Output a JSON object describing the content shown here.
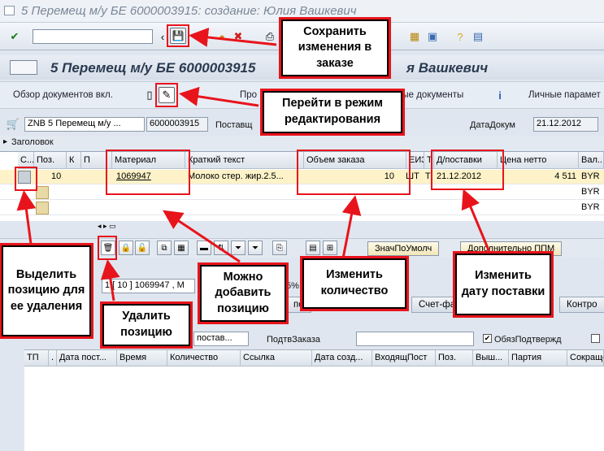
{
  "window": {
    "title": "5 Перемещ м/у БЕ 6000003915: создание: Юлия Вашкевич"
  },
  "app": {
    "title": "5 Перемещ м/у БЕ 6000003915",
    "title_tail": "я Вашкевич"
  },
  "toolbar": {
    "overview_label": "Обзор документов вкл.",
    "pro_label": "Про",
    "docs_label": "ные документы",
    "personal_label": "Личные парамет"
  },
  "header": {
    "doctype": "ZNB 5 Перемещ м/у ...",
    "docnum": "6000003915",
    "supplier_label": "Поставщ",
    "date_label": "ДатаДокум",
    "date_value": "21.12.2012",
    "section_label": "Заголовок"
  },
  "grid": {
    "columns": [
      "С...",
      "Поз.",
      "К",
      "П",
      "Материал",
      "Краткий текст",
      "Объем заказа",
      "ЕИЗ",
      "Т",
      "Д/поставки",
      "Цена нетто",
      "Вал..."
    ],
    "rows": [
      {
        "pos": "10",
        "material": "1069947",
        "text": "Молоко стер. жир.2.5...",
        "qty": "10",
        "uom": "ШТ",
        "t": "Т",
        "date": "21.12.2012",
        "price": "4 511",
        "cur": "BYR"
      },
      {
        "cur": "BYR"
      },
      {
        "cur": "BYR"
      }
    ]
  },
  "lowtool": {
    "default_btn": "ЗначПоУмолч",
    "extra_btn": "Дополнительно ППМ"
  },
  "item": {
    "selector": "1 [ 10 ] 1069947 , М",
    "percent": "5%",
    "tabs": [
      "по",
      "Счет-фа",
      "Контро"
    ],
    "supplier_dd": "постав...",
    "confirm_label": "ПодтвЗаказа",
    "required_label": "ОбязПодтвержд"
  },
  "btable": {
    "columns": [
      "ТП",
      ".",
      "Дата пост...",
      "Время",
      "Количество",
      "Ссылка",
      "Дата созд...",
      "ВходящПост",
      "Поз.",
      "Выш...",
      "Партия",
      "Сокраще"
    ]
  },
  "callouts": {
    "save": "Сохранить изменения в заказе",
    "edit": "Перейти в режим редактирования",
    "select": "Выделить позицию для ее удаления",
    "delete": "Удалить позицию",
    "add": "Можно добавить позицию",
    "qty": "Изменить количество",
    "date": "Изменить дату поставки"
  },
  "colors": {
    "accent_red": "#e8141c",
    "row_highlight": "#fdf2c8"
  }
}
